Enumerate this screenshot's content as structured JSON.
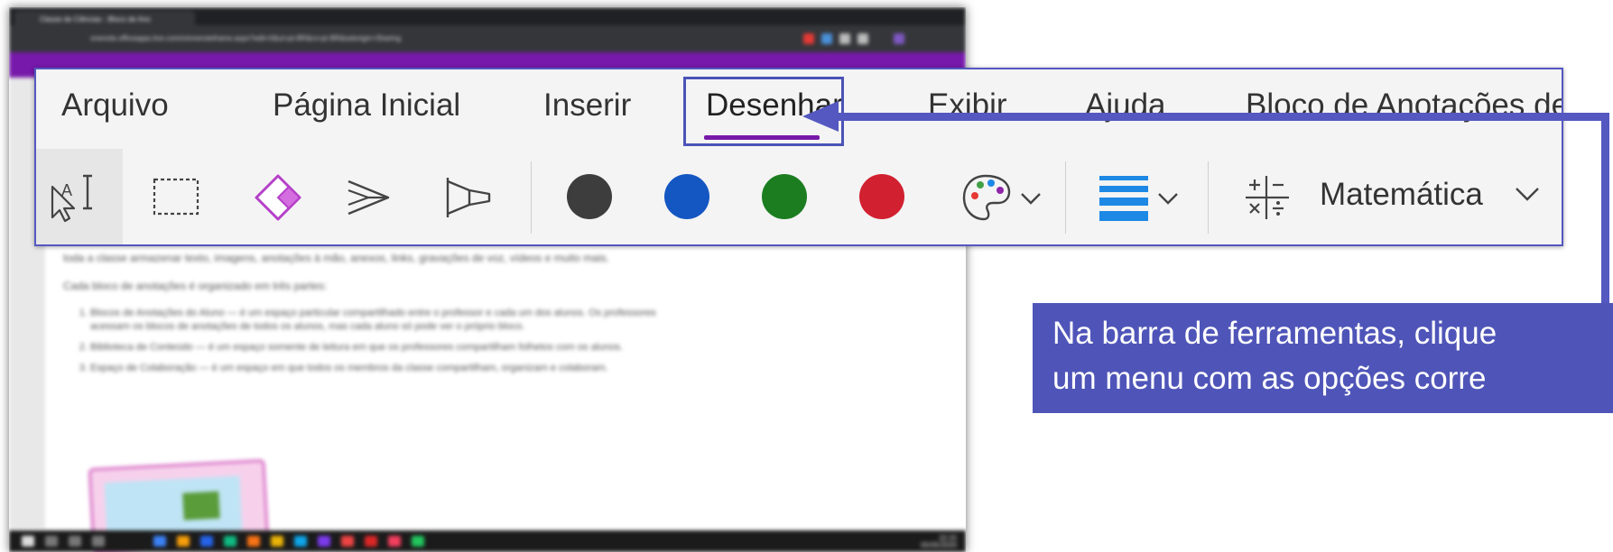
{
  "background_window": {
    "tab_title": "Classe de Ciências - Bloco de Ano",
    "url": "onenote.officeapps.live.com/o/onenoteframe.aspx?edit=0&ui=pt-BR&rs=pt-BR&wdorigin=Sharing",
    "content_paragraph_1": "toda a classe armazenar texto, imagens, anotações à mão, anexos, links, gravações de voz, vídeos e muito mais.",
    "content_paragraph_2": "Cada bloco de anotações é organizado em três partes:",
    "content_list": [
      "Blocos de Anotações do Aluno — é um espaço particular compartilhado entre o professor e cada um dos alunos. Os professores acessam os blocos de anotações de todos os alunos, mas cada aluno só pode ver o próprio bloco.",
      "Biblioteca de Conteúdo — é um espaço somente de leitura em que os professores compartilham folhetos com os alunos.",
      "Espaço de Colaboração — é um espaço em que todos os membros da classe compartilham, organizam e colaboram."
    ],
    "clock": "10:15\n05/05/2020"
  },
  "ribbon": {
    "menu_items": [
      "Arquivo",
      "Página Inicial",
      "Inserir",
      "Desenhar",
      "Exibir",
      "Ajuda",
      "Bloco de Anotações de Classe"
    ],
    "active_tab": "Desenhar",
    "tools": {
      "lasso": "lasso-select-text-icon",
      "select": "rectangle-select-icon",
      "eraser": "eraser-icon",
      "pen_1": "pen-icon",
      "pen_2": "highlighter-icon",
      "palette": "color-palette-icon",
      "thickness": "line-thickness-icon",
      "math_icon": "math-symbols-icon",
      "math_label": "Matemática"
    },
    "pen_colors": [
      "#3d3d3d",
      "#1457c2",
      "#1b7d20",
      "#d12030"
    ],
    "accent_underline_color": "#7719aa"
  },
  "callout": {
    "line_1": "Na barra de ferramentas, clique",
    "line_2": "um menu com as opções corre",
    "color": "#4f55b8"
  }
}
